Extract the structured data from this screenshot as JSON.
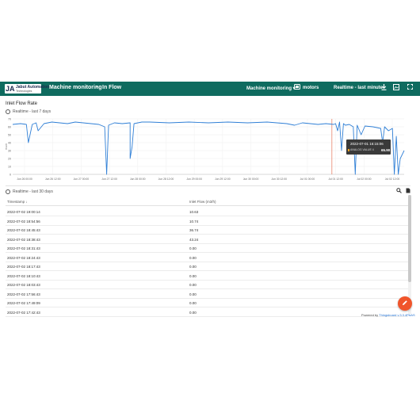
{
  "topbar": {
    "logo_mark": "JA",
    "logo_title": "Jabut Automation",
    "logo_sub": "Technologies",
    "breadcrumb_parent": "Machine monitoring",
    "breadcrumb_sep": "›",
    "breadcrumb_current": "In Flow",
    "dashboard_select": "Machine monitoring",
    "state_label": "motors",
    "time_window": "Realtime - last minute"
  },
  "chart_panel": {
    "title": "Inlet Flow Rate",
    "time_label": "Realtime - last 7 days",
    "tooltip_date": "2022-07-01 16:15:06",
    "tooltip_key": "ANALOG VALUE 4",
    "tooltip_value": "65.90"
  },
  "table_panel": {
    "time_label": "Realtime - last 30 days",
    "col_timestamp": "Timestamp",
    "col_value": "Inlet Flow (m3/h)",
    "rows": [
      {
        "ts": "2022-07-02 19:00:14",
        "val": "10.63"
      },
      {
        "ts": "2022-07-02 18:54:56",
        "val": "10.74"
      },
      {
        "ts": "2022-07-02 18:45:43",
        "val": "36.74"
      },
      {
        "ts": "2022-07-02 18:38:43",
        "val": "43.24"
      },
      {
        "ts": "2022-07-02 18:31:43",
        "val": "0.00"
      },
      {
        "ts": "2022-07-02 18:24:43",
        "val": "0.00"
      },
      {
        "ts": "2022-07-02 18:17:43",
        "val": "0.00"
      },
      {
        "ts": "2022-07-02 18:10:43",
        "val": "0.00"
      },
      {
        "ts": "2022-07-02 18:03:43",
        "val": "0.00"
      },
      {
        "ts": "2022-07-02 17:56:43",
        "val": "0.00"
      },
      {
        "ts": "2022-07-02 17:49:09",
        "val": "0.00"
      },
      {
        "ts": "2022-07-02 17:42:43",
        "val": "0.00"
      }
    ]
  },
  "footer": {
    "powered_prefix": "Powered by",
    "powered_brand": "Thingsboard v.3.3.4PAAS"
  },
  "colors": {
    "topbar": "#0f6b5f",
    "line": "#2f7fd6",
    "fab": "#f0552b"
  },
  "chart_data": {
    "type": "line",
    "title": "Inlet Flow Rate",
    "ylabel": "m3/h",
    "ylim": [
      0,
      70
    ],
    "yticks": [
      0,
      10,
      20,
      30,
      40,
      50,
      60,
      70
    ],
    "xticks": [
      "Jun 26 00:00",
      "Jun 26 12:00",
      "Jun 27 00:00",
      "Jun 27 12:00",
      "Jun 28 00:00",
      "Jun 28 12:00",
      "Jun 29 00:00",
      "Jun 29 12:00",
      "Jun 30 00:00",
      "Jun 30 12:00",
      "Jul 01 00:00",
      "Jul 01 12:00",
      "Jul 02 00:00",
      "Jul 02 12:00"
    ],
    "series": [
      {
        "x": [
          0,
          0.02,
          0.035,
          0.04,
          0.05,
          0.06,
          0.065,
          0.08,
          0.1,
          0.12,
          0.14,
          0.16,
          0.18,
          0.2,
          0.22,
          0.235,
          0.24,
          0.245,
          0.26,
          0.28,
          0.3,
          0.3,
          0.305,
          0.31,
          0.33,
          0.35,
          0.4,
          0.45,
          0.5,
          0.55,
          0.6,
          0.65,
          0.7,
          0.72,
          0.74,
          0.76,
          0.78,
          0.8,
          0.82,
          0.825,
          0.83,
          0.835,
          0.84,
          0.845,
          0.85,
          0.86,
          0.87,
          0.875,
          0.88,
          0.89,
          0.9,
          0.92,
          0.94,
          0.945,
          0.95,
          0.96,
          0.97,
          0.975,
          0.98,
          0.985,
          0.99,
          1.0
        ],
        "y": [
          63,
          64,
          63,
          40,
          63,
          65,
          55,
          64,
          66,
          65,
          64,
          66,
          65,
          64,
          63,
          60,
          0,
          62,
          65,
          64,
          65,
          20,
          35,
          64,
          66,
          66,
          65,
          66,
          65,
          66,
          65,
          66,
          64,
          62,
          65,
          64,
          63,
          64,
          63,
          64,
          55,
          66,
          30,
          64,
          62,
          63,
          60,
          0,
          62,
          50,
          61,
          60,
          58,
          40,
          60,
          55,
          58,
          0,
          48,
          0,
          20,
          30
        ]
      }
    ]
  }
}
